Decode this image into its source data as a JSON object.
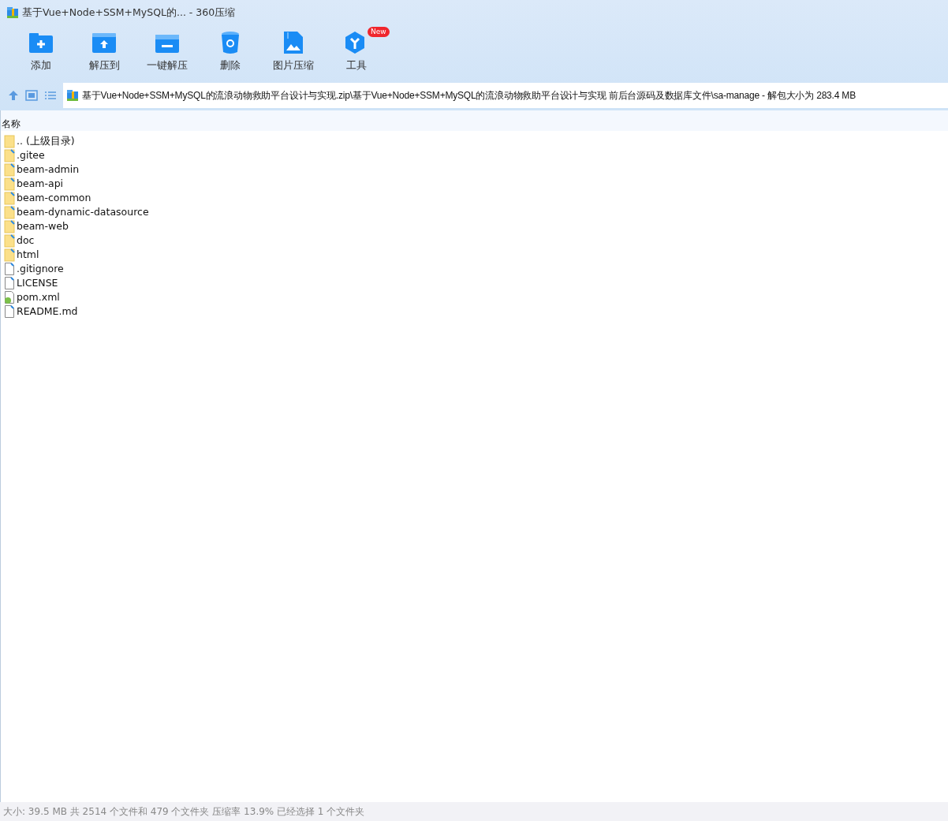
{
  "window": {
    "title": "基于Vue+Node+SSM+MySQL的... - 360压缩"
  },
  "toolbar": [
    {
      "kind": "add",
      "label": "添加"
    },
    {
      "kind": "extract",
      "label": "解压到"
    },
    {
      "kind": "oneclick",
      "label": "一键解压"
    },
    {
      "kind": "delete",
      "label": "删除"
    },
    {
      "kind": "image",
      "label": "图片压缩"
    },
    {
      "kind": "tools",
      "label": "工具",
      "badge": "New"
    }
  ],
  "address": {
    "path": "基于Vue+Node+SSM+MySQL的流浪动物救助平台设计与实现.zip\\基于Vue+Node+SSM+MySQL的流浪动物救助平台设计与实现 前后台源码及数据库文件\\sa-manage - 解包大小为 283.4 MB"
  },
  "table": {
    "columns": [
      "名称"
    ],
    "rows": [
      {
        "kind": "parent",
        "name": ".. (上级目录)"
      },
      {
        "kind": "folder",
        "name": ".gitee"
      },
      {
        "kind": "folder",
        "name": "beam-admin"
      },
      {
        "kind": "folder",
        "name": "beam-api"
      },
      {
        "kind": "folder",
        "name": "beam-common"
      },
      {
        "kind": "folder",
        "name": "beam-dynamic-datasource"
      },
      {
        "kind": "folder",
        "name": "beam-web"
      },
      {
        "kind": "folder",
        "name": "doc"
      },
      {
        "kind": "folder",
        "name": "html"
      },
      {
        "kind": "file",
        "name": ".gitignore"
      },
      {
        "kind": "file",
        "name": "LICENSE"
      },
      {
        "kind": "xml",
        "name": "pom.xml"
      },
      {
        "kind": "file",
        "name": "README.md"
      }
    ]
  },
  "status_bar": "大小: 39.5 MB 共 2514 个文件和 479 个文件夹 压缩率 13.9% 已经选择 1 个文件夹"
}
